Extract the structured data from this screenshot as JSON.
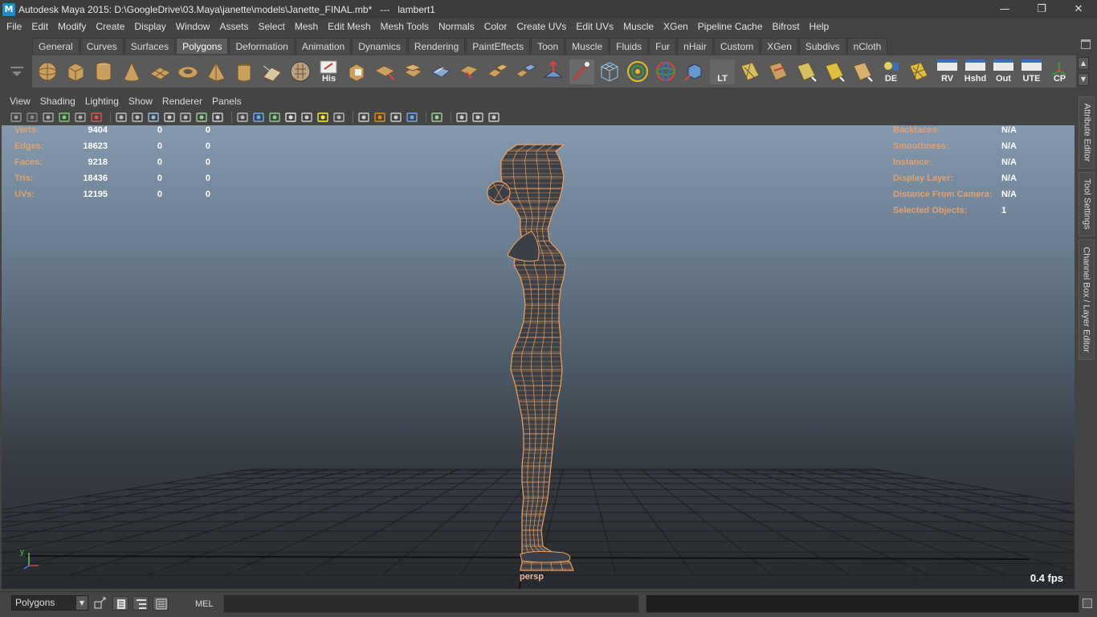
{
  "window": {
    "title": "Autodesk Maya 2015: D:\\GoogleDrive\\03.Maya\\janette\\models\\Janette_FINAL.mb*   ---   lambert1",
    "icon": "maya-logo-icon",
    "controls": [
      "minimize-icon",
      "restore-icon",
      "close-icon"
    ]
  },
  "menubar": [
    "File",
    "Edit",
    "Modify",
    "Create",
    "Display",
    "Window",
    "Assets",
    "Select",
    "Mesh",
    "Edit Mesh",
    "Mesh Tools",
    "Normals",
    "Color",
    "Create UVs",
    "Edit UVs",
    "Muscle",
    "XGen",
    "Pipeline Cache",
    "Bifrost",
    "Help"
  ],
  "shelf": {
    "tabs": [
      "General",
      "Curves",
      "Surfaces",
      "Polygons",
      "Deformation",
      "Animation",
      "Dynamics",
      "Rendering",
      "PaintEffects",
      "Toon",
      "Muscle",
      "Fluids",
      "Fur",
      "nHair",
      "Custom",
      "XGen",
      "Subdivs",
      "nCloth"
    ],
    "active_tab": "Polygons",
    "icon_labels": {
      "his": "His",
      "lt": "LT",
      "de": "DE",
      "rv": "RV",
      "hshd": "Hshd",
      "out": "Out",
      "ute": "UTE",
      "cp": "CP"
    }
  },
  "panel": {
    "menus": [
      "View",
      "Shading",
      "Lighting",
      "Show",
      "Renderer",
      "Panels"
    ]
  },
  "hud_left": [
    {
      "label": "Verts:",
      "value": "9404",
      "sel1": "0",
      "sel2": "0"
    },
    {
      "label": "Edges:",
      "value": "18623",
      "sel1": "0",
      "sel2": "0"
    },
    {
      "label": "Faces:",
      "value": "9218",
      "sel1": "0",
      "sel2": "0"
    },
    {
      "label": "Tris:",
      "value": "18436",
      "sel1": "0",
      "sel2": "0"
    },
    {
      "label": "UVs:",
      "value": "12195",
      "sel1": "0",
      "sel2": "0"
    }
  ],
  "hud_right": [
    {
      "label": "Backfaces:",
      "value": "N/A"
    },
    {
      "label": "Smoothness:",
      "value": "N/A"
    },
    {
      "label": "Instance:",
      "value": "N/A"
    },
    {
      "label": "Display Layer:",
      "value": "N/A"
    },
    {
      "label": "Distance From Camera:",
      "value": "N/A"
    },
    {
      "label": "Selected Objects:",
      "value": "1"
    }
  ],
  "viewport": {
    "camera": "persp",
    "fps": "0.4 fps",
    "axis_label": "y",
    "wire_color": "#f0a060"
  },
  "side_tabs": [
    "Attribute Editor",
    "Tool Settings",
    "Channel Box / Layer Editor"
  ],
  "commandline": {
    "mode": "Polygons",
    "language": "MEL"
  }
}
